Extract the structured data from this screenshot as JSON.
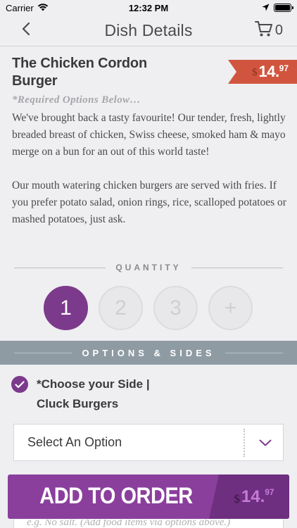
{
  "status_bar": {
    "carrier": "Carrier",
    "time": "12:32 PM",
    "icons": [
      "wifi-icon",
      "location-arrow-icon",
      "battery-icon"
    ]
  },
  "nav": {
    "title": "Dish Details",
    "cart_count": "0",
    "icons": [
      "back-chevron-icon",
      "cart-icon"
    ]
  },
  "dish": {
    "name": "The Chicken Cordon Burger",
    "price_symbol": "$",
    "price_main": "14.",
    "price_cents": "97",
    "required_note": "*Required Options Below…",
    "description": [
      "We've brought back a tasty favourite! Our tender, fresh, lightly breaded breast of chicken, Swiss cheese, smoked ham & mayo merge on a bun for an out of this world taste!",
      "Our mouth watering chicken burgers are served with fries. If you prefer potato salad, onion rings, rice, scalloped potatoes or mashed potatoes, just ask."
    ]
  },
  "quantity": {
    "label": "QUANTITY",
    "options": [
      "1",
      "2",
      "3",
      "+"
    ],
    "selected": "1"
  },
  "options": {
    "header": "OPTIONS & SIDES",
    "choice_label": "*Choose your Side | Cluck Burgers",
    "select_value": "Select An Option"
  },
  "add_to_order": {
    "label": "ADD TO ORDER",
    "price_symbol": "$",
    "price_main": "14.",
    "price_cents": "97"
  },
  "notes": {
    "placeholder": "e.g. No salt. (Add food items via options above.)"
  },
  "colors": {
    "accent_purple": "#7c3a8c",
    "price_tag_red": "#d1553e",
    "options_bar_gray": "#8f9ba3"
  }
}
